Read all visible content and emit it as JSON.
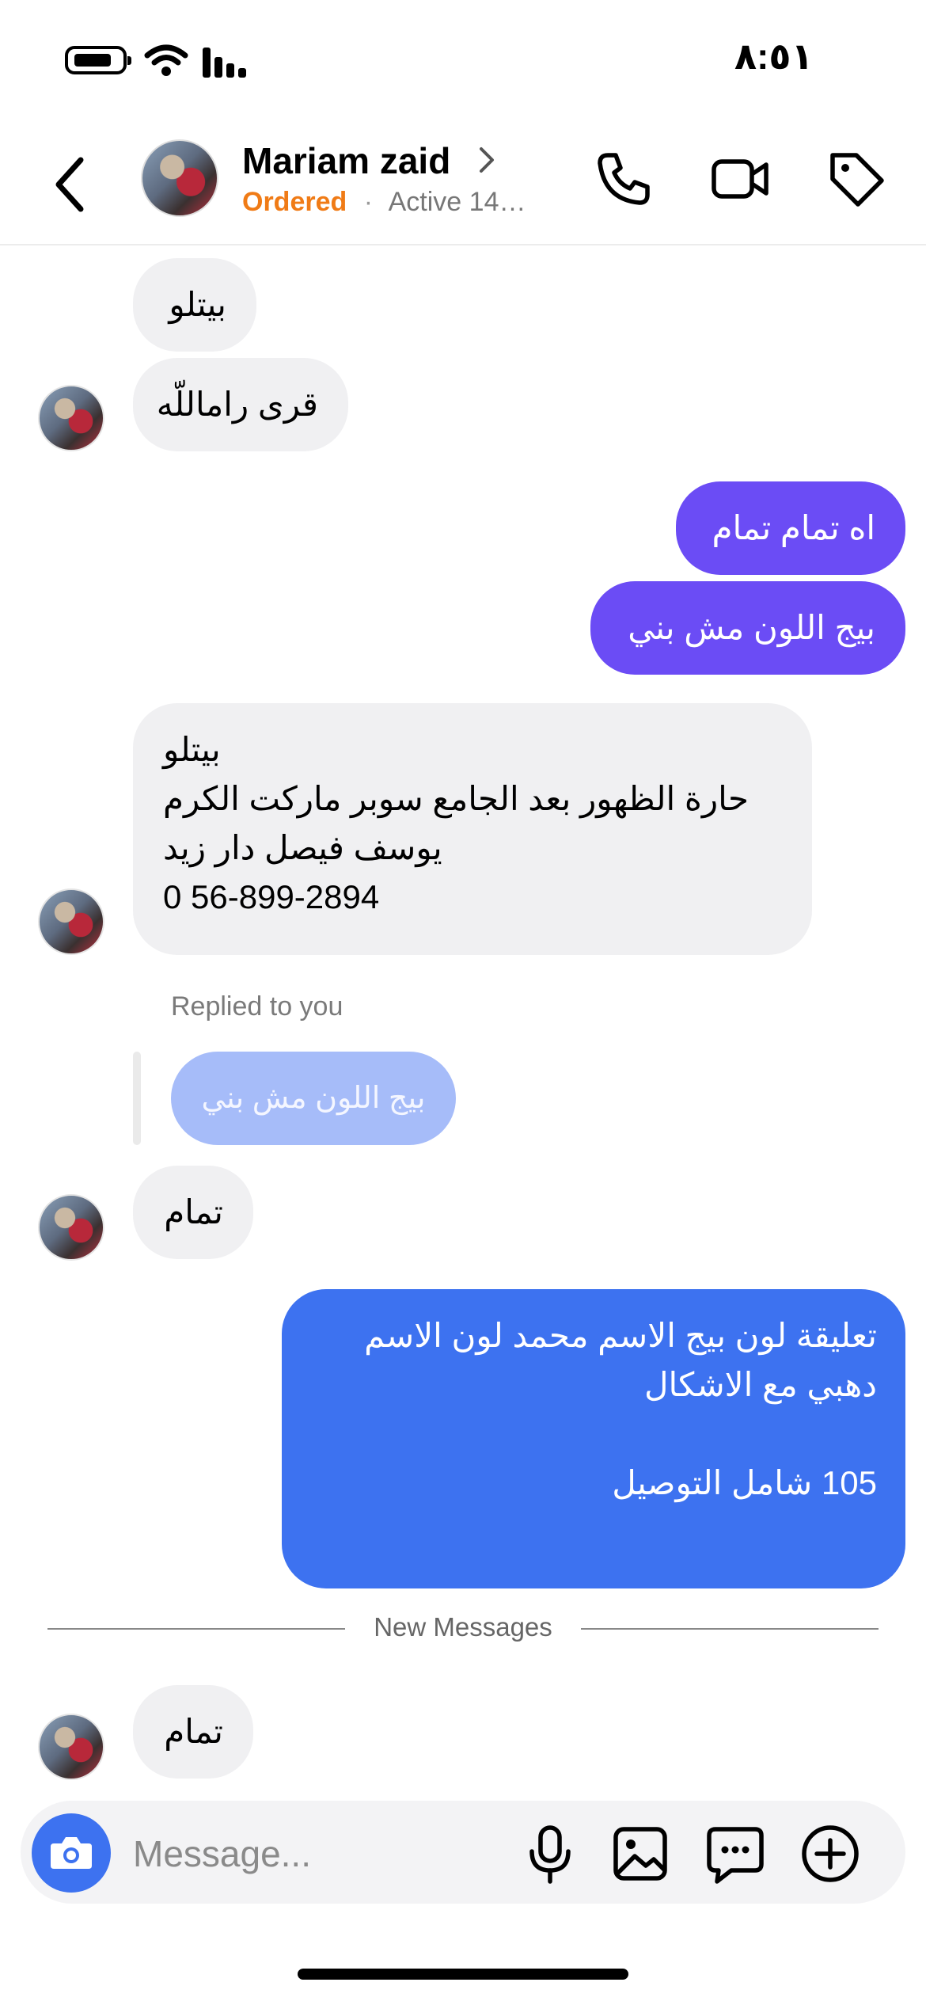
{
  "status_bar": {
    "time": "٨:٥١"
  },
  "header": {
    "contact_name": "Mariam zaid",
    "order_status": "Ordered",
    "separator": "·",
    "activity": "Active 14…"
  },
  "messages": {
    "m1": "بيتلو",
    "m2": "قرى راماللّه",
    "m3": "اه تمام تمام",
    "m4": "بيج اللون مش بني",
    "m5_lines": [
      "بيتلو",
      "حارة الظهور  بعد الجامع سوبر ماركت الكرم",
      "يوسف فيصل دار زيد",
      "0 56-899-2894"
    ],
    "replied_label": "Replied to you",
    "reply_quote": "بيج اللون مش بني",
    "m6": "تمام",
    "m7_lines": [
      "تعليقة لون بيج الاسم محمد لون الاسم",
      "دهبي مع الاشكال",
      "",
      "105 شامل التوصيل"
    ],
    "new_messages_label": "New Messages",
    "m8": "تمام"
  },
  "composer": {
    "placeholder": "Message..."
  },
  "colors": {
    "accent_purple": "#6b4cf5",
    "accent_blue": "#3d72f0",
    "ordered_orange": "#f07b16",
    "incoming_bubble": "#f0f0f2"
  },
  "icons": [
    "battery-icon",
    "wifi-icon",
    "signal-icon",
    "back-icon",
    "chevron-right-icon",
    "phone-icon",
    "video-icon",
    "tag-icon",
    "camera-icon",
    "microphone-icon",
    "image-icon",
    "sticker-icon",
    "plus-icon"
  ]
}
